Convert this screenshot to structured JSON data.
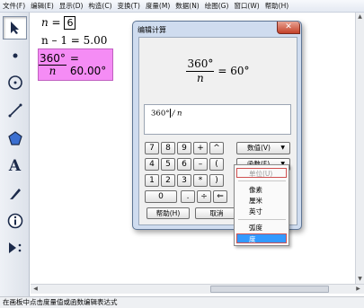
{
  "menubar": {
    "items": [
      "文件(F)",
      "编辑(E)",
      "显示(D)",
      "构造(C)",
      "变换(T)",
      "度量(M)",
      "数据(N)",
      "绘图(G)",
      "窗口(W)",
      "帮助(H)"
    ]
  },
  "toolbox": {
    "tools": [
      {
        "name": "arrow-select-tool",
        "glyph": "➔"
      },
      {
        "name": "point-tool",
        "glyph": "•"
      },
      {
        "name": "compass-tool",
        "glyph": "⊙"
      },
      {
        "name": "line-tool",
        "glyph": "╱"
      },
      {
        "name": "polygon-tool",
        "glyph": "⬟"
      },
      {
        "name": "text-tool",
        "glyph": "A"
      },
      {
        "name": "marker-tool",
        "glyph": "✎"
      },
      {
        "name": "information-tool",
        "glyph": "ⓘ"
      },
      {
        "name": "custom-tool",
        "glyph": "▶"
      }
    ]
  },
  "canvas": {
    "param_label": "n =",
    "param_value": "6",
    "measure_line": "n – 1 = 5.00",
    "calc_num": "360°",
    "calc_den": "n",
    "calc_result": "= 60.00°",
    "calc_color": "#f58cf5"
  },
  "dialog": {
    "title": "编辑计算",
    "close_glyph": "✕",
    "preview_num": "360°",
    "preview_den": "n",
    "preview_result": "= 60°",
    "expr_left": "360°",
    "expr_right": "/ n",
    "keys": [
      "7",
      "8",
      "9",
      "+",
      "^",
      "4",
      "5",
      "6",
      "–",
      "(",
      "1",
      "2",
      "3",
      "*",
      ")",
      "0",
      ".",
      "÷",
      "⇐"
    ],
    "dropdowns": [
      "数值(V)",
      "函数(F)",
      "单位(U)"
    ],
    "help_label": "帮助(H)",
    "cancel_label": "取消"
  },
  "units_menu": {
    "header": "单位(U)",
    "length_units": [
      "像素",
      "厘米",
      "英寸"
    ],
    "angle_units": [
      "弧度",
      "度"
    ],
    "selected": "度"
  },
  "statusbar": {
    "text": "在画板中点击度量值或函数编辑表达式"
  }
}
